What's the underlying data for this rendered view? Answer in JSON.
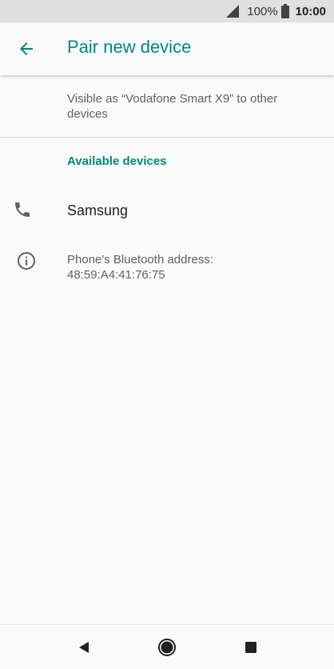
{
  "status_bar": {
    "battery_percent": "100%",
    "time": "10:00",
    "icons": [
      "signal-icon",
      "battery-icon"
    ]
  },
  "app_bar": {
    "title": "Pair new device",
    "back_icon": "arrow-left-icon"
  },
  "visibility_text": "Visible as “Vodafone Smart X9” to other devices",
  "section_header": "Available devices",
  "devices": [
    {
      "name": "Samsung",
      "icon": "phone-icon"
    }
  ],
  "info": {
    "icon": "info-icon",
    "text": "Phone's Bluetooth address: 48:59:A4:41:76:75"
  },
  "colors": {
    "accent": "#00897b",
    "status_bar_bg": "#e0e0e0",
    "background": "#fafafa",
    "icon_grey": "#616161"
  },
  "nav_bar": {
    "icons": [
      "triangle-back-icon",
      "circle-home-icon",
      "square-recents-icon"
    ]
  }
}
